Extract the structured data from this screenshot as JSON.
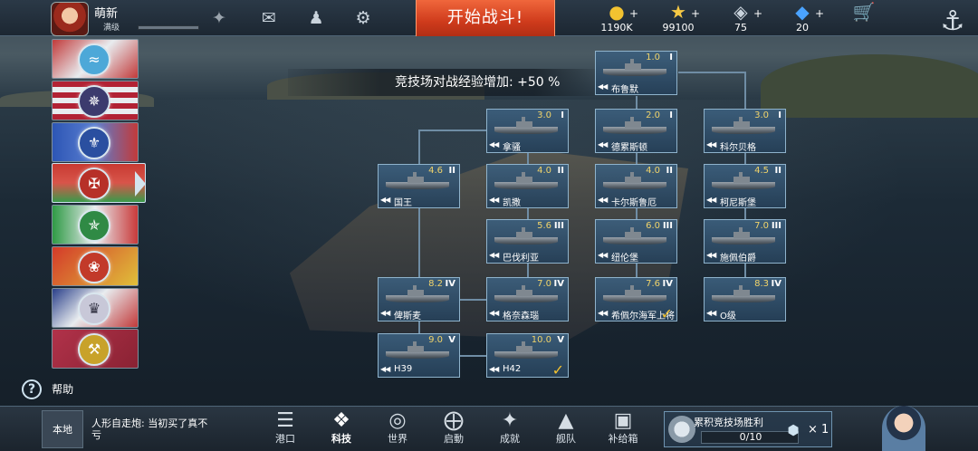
{
  "player": {
    "name": "萌新",
    "level_label": "满级"
  },
  "topbar": {
    "battle_button": "开始战斗!",
    "icons": [
      "mail-icon",
      "friends-icon",
      "settings-icon"
    ],
    "resources": [
      {
        "name": "coin-icon",
        "value": "1190K",
        "color": "#f2c230"
      },
      {
        "name": "star-icon",
        "value": "99100",
        "color": "#f6c945"
      },
      {
        "name": "chip-icon",
        "value": "75",
        "color": "#aeb9c3"
      },
      {
        "name": "diamond-icon",
        "value": "20",
        "color": "#4aa3ff"
      },
      {
        "name": "shop-cart-icon",
        "value": ""
      }
    ]
  },
  "nations": [
    {
      "name": "nation-tab-1",
      "colors": [
        "#c23a3a",
        "#e8ecef"
      ]
    },
    {
      "name": "nation-tab-2",
      "colors": [
        "#b22234",
        "#e8ecef",
        "#3c3b6e"
      ]
    },
    {
      "name": "nation-tab-3",
      "colors": [
        "#2d56b5",
        "#e8ecef"
      ]
    },
    {
      "name": "nation-tab-4",
      "colors": [
        "#d23a3a",
        "#3a9a4a"
      ],
      "active": true
    },
    {
      "name": "nation-tab-5",
      "colors": [
        "#2f9a45",
        "#e8ecef",
        "#c93a3a"
      ]
    },
    {
      "name": "nation-tab-6",
      "colors": [
        "#d43a2a",
        "#e0c03a"
      ]
    },
    {
      "name": "nation-tab-7",
      "colors": [
        "#c23a3a",
        "#2a3f8a",
        "#e8ecef"
      ]
    },
    {
      "name": "nation-tab-8",
      "colors": [
        "#b1324a",
        "#e0c03a"
      ]
    }
  ],
  "help": {
    "label": "帮助"
  },
  "tree": {
    "bonus_text": "竞技场对战经验增加:  +50 %",
    "ships": [
      {
        "id": "brummer",
        "name": "布鲁默",
        "tier": "1.0",
        "roman": "I"
      },
      {
        "id": "nassau",
        "name": "拿骚",
        "tier": "3.0",
        "roman": "I"
      },
      {
        "id": "dresden",
        "name": "德累斯顿",
        "tier": "2.0",
        "roman": "I"
      },
      {
        "id": "koenigsberg",
        "name": "科尔贝格",
        "tier": "3.0",
        "roman": "I"
      },
      {
        "id": "koenig",
        "name": "国王",
        "tier": "4.6",
        "roman": "II"
      },
      {
        "id": "kaiser",
        "name": "凯撒",
        "tier": "4.0",
        "roman": "II"
      },
      {
        "id": "karlsruhe",
        "name": "卡尔斯鲁厄",
        "tier": "4.0",
        "roman": "II"
      },
      {
        "id": "kolberg",
        "name": "柯尼斯堡",
        "tier": "4.5",
        "roman": "II"
      },
      {
        "id": "bayern",
        "name": "巴伐利亚",
        "tier": "5.6",
        "roman": "III"
      },
      {
        "id": "nuernberg",
        "name": "纽伦堡",
        "tier": "6.0",
        "roman": "III"
      },
      {
        "id": "spee",
        "name": "施佩伯爵",
        "tier": "7.0",
        "roman": "III"
      },
      {
        "id": "bismarck",
        "name": "俾斯麦",
        "tier": "8.2",
        "roman": "IV"
      },
      {
        "id": "gneisenau",
        "name": "格奈森瑙",
        "tier": "7.0",
        "roman": "IV"
      },
      {
        "id": "hipper",
        "name": "希佩尔海军上将",
        "tier": "7.6",
        "roman": "IV",
        "checked": true
      },
      {
        "id": "o-class",
        "name": "O级",
        "tier": "8.3",
        "roman": "IV"
      },
      {
        "id": "h39",
        "name": "H39",
        "tier": "9.0",
        "roman": "V"
      },
      {
        "id": "h42",
        "name": "H42",
        "tier": "10.0",
        "roman": "V",
        "checked": true
      }
    ]
  },
  "bottombar": {
    "local_button": "本地",
    "chat_message": "人形自走炮: 当初买了真不亏",
    "nav": [
      {
        "id": "harbor",
        "label": "港口",
        "icon": "harbor-icon"
      },
      {
        "id": "tech",
        "label": "科技",
        "icon": "tech-icon",
        "active": true
      },
      {
        "id": "world",
        "label": "世界",
        "icon": "globe-icon"
      },
      {
        "id": "launch",
        "label": "启動",
        "icon": "launch-icon"
      },
      {
        "id": "achievement",
        "label": "成就",
        "icon": "medal-icon"
      },
      {
        "id": "fleet",
        "label": "舰队",
        "icon": "fleet-icon"
      },
      {
        "id": "supply",
        "label": "补给箱",
        "icon": "supply-box-icon"
      }
    ],
    "arena_progress": {
      "title": "累积竞技场胜利",
      "current": 0,
      "total": 10,
      "text": "0/10",
      "reward_count": "× 1"
    }
  }
}
